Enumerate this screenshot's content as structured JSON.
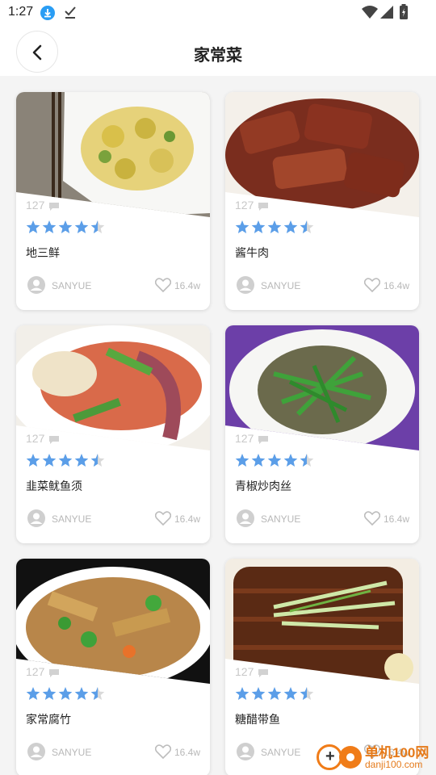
{
  "status_bar": {
    "time": "1:27"
  },
  "header": {
    "title": "家常菜"
  },
  "cards": [
    {
      "name": "地三鲜",
      "views": "127",
      "author": "SANYUE",
      "likes": "16.4w",
      "rating": 4.5,
      "photo": "potato-dish-photo"
    },
    {
      "name": "酱牛肉",
      "views": "127",
      "author": "SANYUE",
      "likes": "16.4w",
      "rating": 4.5,
      "photo": "braised-beef-photo"
    },
    {
      "name": "韭菜鱿鱼须",
      "views": "127",
      "author": "SANYUE",
      "likes": "16.4w",
      "rating": 4.5,
      "photo": "squid-dish-photo"
    },
    {
      "name": "青椒炒肉丝",
      "views": "127",
      "author": "SANYUE",
      "likes": "16.4w",
      "rating": 4.5,
      "photo": "pepper-pork-photo"
    },
    {
      "name": "家常腐竹",
      "views": "127",
      "author": "SANYUE",
      "likes": "16.4w",
      "rating": 4.5,
      "photo": "tofu-skin-photo"
    },
    {
      "name": "糖醋带鱼",
      "views": "127",
      "author": "SANYUE",
      "likes": "16.4w",
      "rating": 4.5,
      "photo": "hairtail-fish-photo"
    }
  ],
  "watermark": {
    "text": "单机100网",
    "url": "danji100.com"
  },
  "colors": {
    "star": "#5b9ee8",
    "star_empty": "#d9d9d9",
    "muted_text": "#b8b8b8",
    "brand_orange": "#f07c18"
  }
}
